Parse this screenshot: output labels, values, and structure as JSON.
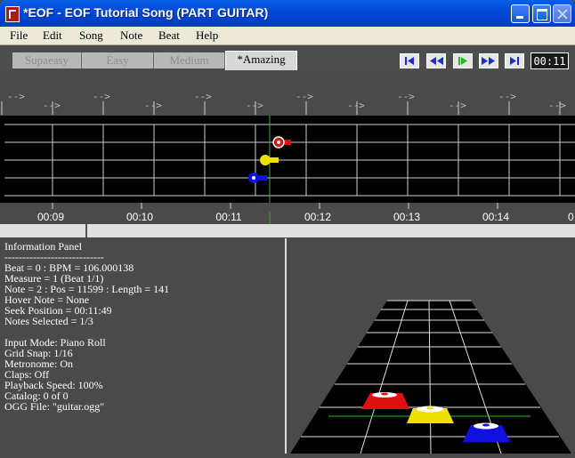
{
  "window": {
    "title": "*EOF - EOF Tutorial Song (PART GUITAR)"
  },
  "menu": [
    "File",
    "Edit",
    "Song",
    "Note",
    "Beat",
    "Help"
  ],
  "difficulties": [
    {
      "label": "Supaeasy",
      "active": false
    },
    {
      "label": "Easy",
      "active": false
    },
    {
      "label": "Medium",
      "active": false
    },
    {
      "label": "*Amazing",
      "active": true
    }
  ],
  "playback": {
    "buttons": [
      "rewind-to-start",
      "rewind",
      "play",
      "fast-forward",
      "seek-to-end"
    ],
    "time": "00:11"
  },
  "timeline": {
    "arrow": "-->",
    "time_labels": [
      "00:09",
      "00:10",
      "00:11",
      "00:12",
      "00:13",
      "00:14"
    ],
    "colors": {
      "red": "#e01010",
      "yellow": "#f0e000",
      "blue": "#1010e0",
      "cursor": "#22bb22"
    }
  },
  "info_panel": {
    "lines": [
      "Information Panel",
      "----------------------------",
      "Beat = 0 : BPM = 106.000138",
      "Measure = 1 (Beat 1/1)",
      "Note = 2 : Pos = 11599 : Length = 141",
      "Hover Note = None",
      "Seek Position = 00:11:49",
      "Notes Selected = 1/3",
      "",
      "Input Mode: Piano Roll",
      "Grid Snap: 1/16",
      "Metronome: On",
      "Claps: Off",
      "Playback Speed: 100%",
      "Catalog: 0 of 0",
      "OGG File: \"guitar.ogg\""
    ]
  }
}
